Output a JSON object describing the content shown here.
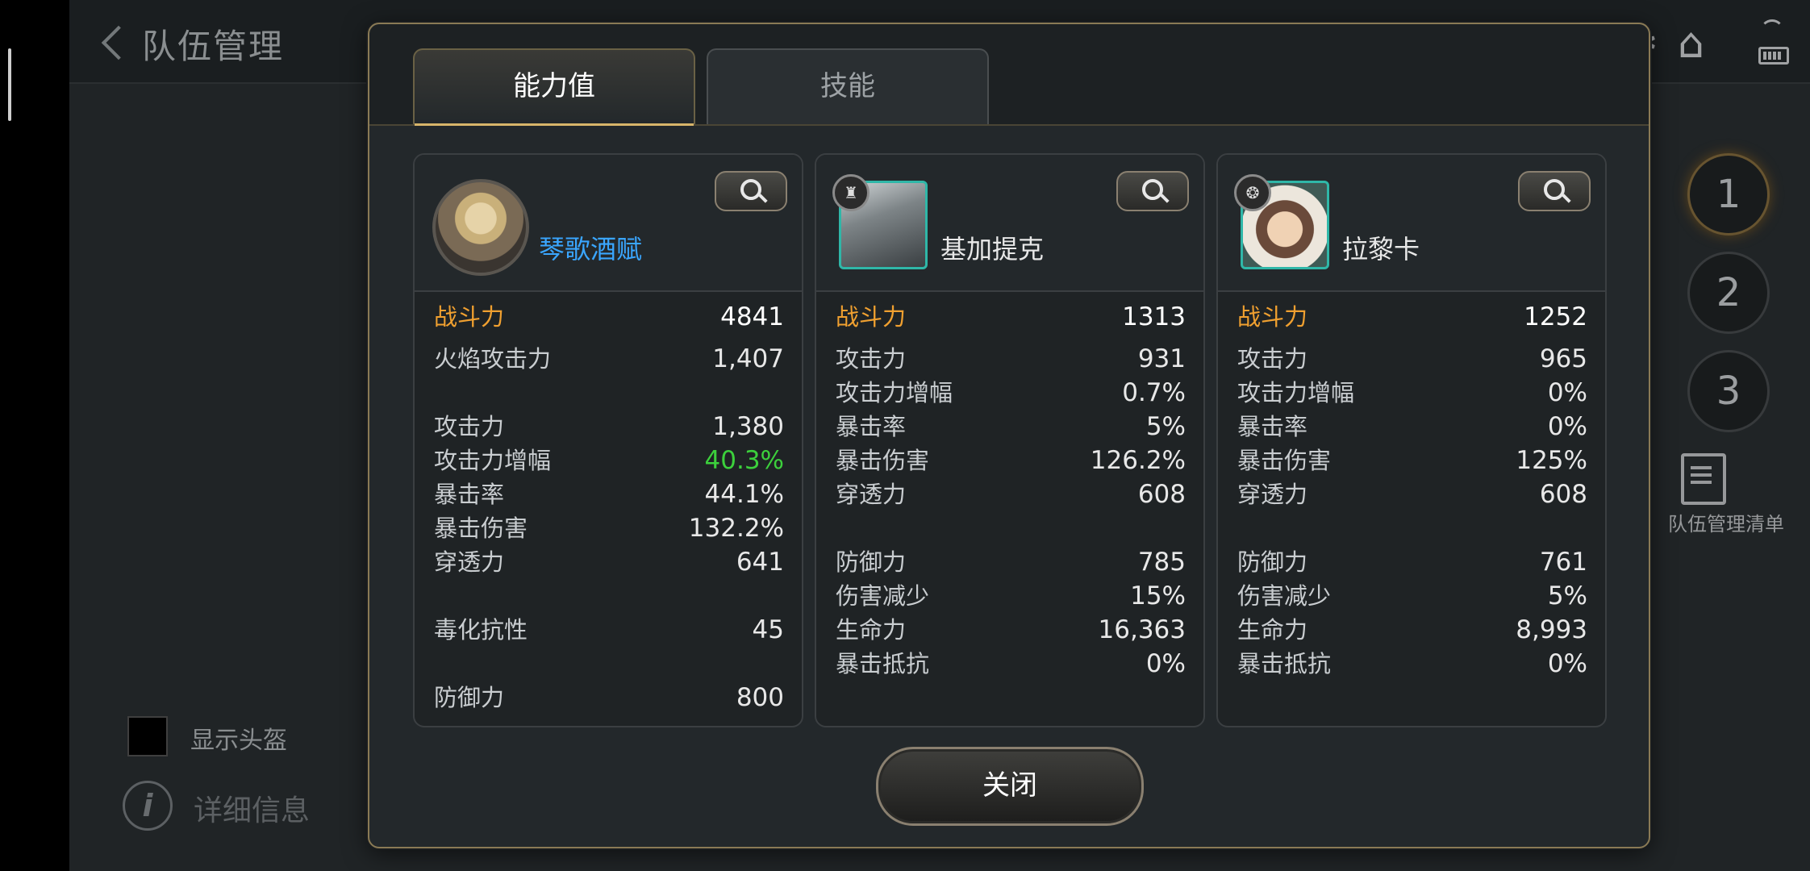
{
  "page": {
    "title": "队伍管理",
    "show_helmet_label": "显示头盔",
    "detail_info_label": "详细信息",
    "team_numbers": [
      "1",
      "2",
      "3"
    ],
    "team_list_label": "队伍管理清单"
  },
  "modal": {
    "tabs": [
      {
        "label": "能力值",
        "active": true
      },
      {
        "label": "技能",
        "active": false
      }
    ],
    "close_label": "关闭",
    "cards": [
      {
        "name": "琴歌酒赋",
        "power_label": "战斗力",
        "power": "4841",
        "stats": [
          {
            "k": "火焰攻击力",
            "v": "1,407"
          },
          {
            "k": "",
            "v": ""
          },
          {
            "k": "攻击力",
            "v": "1,380"
          },
          {
            "k": "攻击力增幅",
            "v": "40.3%"
          },
          {
            "k": "暴击率",
            "v": "44.1%"
          },
          {
            "k": "暴击伤害",
            "v": "132.2%"
          },
          {
            "k": "穿透力",
            "v": "641"
          },
          {
            "k": "",
            "v": ""
          },
          {
            "k": "毒化抗性",
            "v": "45"
          },
          {
            "k": "",
            "v": ""
          },
          {
            "k": "防御力",
            "v": "800"
          }
        ]
      },
      {
        "name": "基加提克",
        "power_label": "战斗力",
        "power": "1313",
        "stats": [
          {
            "k": "攻击力",
            "v": "931"
          },
          {
            "k": "攻击力增幅",
            "v": "0.7%"
          },
          {
            "k": "暴击率",
            "v": "5%"
          },
          {
            "k": "暴击伤害",
            "v": "126.2%"
          },
          {
            "k": "穿透力",
            "v": "608"
          },
          {
            "k": "",
            "v": ""
          },
          {
            "k": "防御力",
            "v": "785"
          },
          {
            "k": "伤害减少",
            "v": "15%"
          },
          {
            "k": "生命力",
            "v": "16,363"
          },
          {
            "k": "暴击抵抗",
            "v": "0%"
          }
        ]
      },
      {
        "name": "拉黎卡",
        "power_label": "战斗力",
        "power": "1252",
        "stats": [
          {
            "k": "攻击力",
            "v": "965"
          },
          {
            "k": "攻击力增幅",
            "v": "0%"
          },
          {
            "k": "暴击率",
            "v": "0%"
          },
          {
            "k": "暴击伤害",
            "v": "125%"
          },
          {
            "k": "穿透力",
            "v": "608"
          },
          {
            "k": "",
            "v": ""
          },
          {
            "k": "防御力",
            "v": "761"
          },
          {
            "k": "伤害减少",
            "v": "5%"
          },
          {
            "k": "生命力",
            "v": "8,993"
          },
          {
            "k": "暴击抵抗",
            "v": "0%"
          }
        ]
      }
    ]
  },
  "icons": {
    "back": "chevron-left-icon",
    "chat": "chat-icon",
    "settings": "gear-icon",
    "home": "home-icon",
    "wifi": "wifi-icon",
    "battery": "battery-icon",
    "search": "search-icon",
    "info": "info-icon",
    "list": "document-list-icon"
  },
  "colors": {
    "power_label": "#f0a030",
    "name_highlight": "#3aa6ff",
    "stat_highlight": "#3cd03c",
    "tab_active_underline": "#d8b56a"
  }
}
